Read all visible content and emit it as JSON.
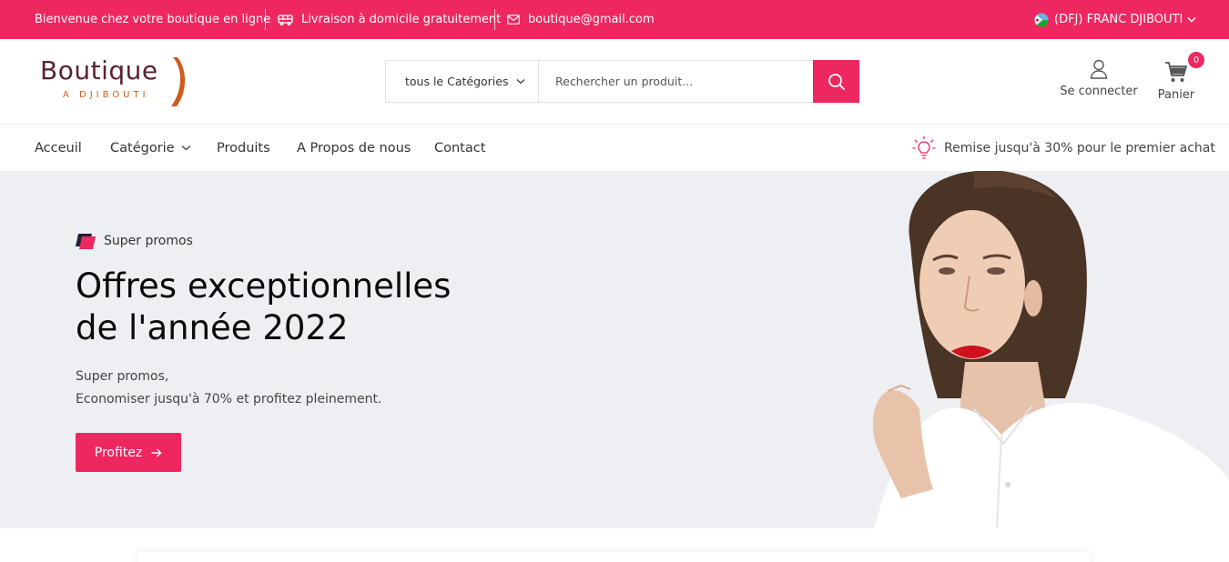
{
  "topbar": {
    "welcome": "Bienvenue chez votre boutique en ligne",
    "delivery": "Livraison à domicile gratuitement",
    "email": "boutique@gmail.com",
    "currency": "(DFJ) FRANC DJIBOUTI",
    "delivery_icon": "truck-icon",
    "email_icon": "envelope-icon",
    "currency_icon": "djibouti-flag-icon"
  },
  "logo": {
    "name": "Boutique",
    "subtitle": "A DJIBOUTI"
  },
  "search": {
    "category_label": "tous le Catégories",
    "placeholder": "Rechercher un produit..."
  },
  "account": {
    "label": "Se connecter"
  },
  "cart": {
    "label": "Panier",
    "count": "0"
  },
  "nav": {
    "items": [
      "Acceuil",
      "Catégorie",
      "Produits",
      "A Propos de nous",
      "Contact"
    ],
    "promo": "Remise jusqu'à 30% pour le premier achat"
  },
  "hero": {
    "tag": "Super promos",
    "title_line1": "Offres exceptionnelles",
    "title_line2": "de l'année 2022",
    "desc_line1": "Super promos,",
    "desc_line2": "Economiser jusqu'à 70% et profitez pleinement.",
    "cta": "Profitez"
  },
  "colors": {
    "brand": "#ee2761",
    "hero_bg": "#eeeff2",
    "logo_text": "#5a2230",
    "logo_accent": "#d15a1e"
  }
}
